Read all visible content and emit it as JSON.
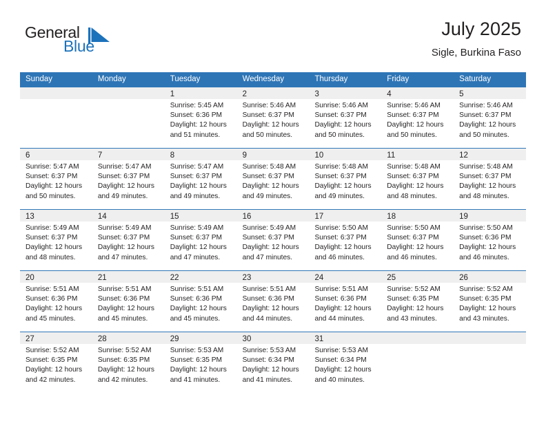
{
  "brand": {
    "name_part1": "General",
    "name_part2": "Blue",
    "logo_icon": "blue-triangle-flag-icon",
    "accent_color": "#1c72bb"
  },
  "header": {
    "title": "July 2025",
    "subtitle": "Sigle, Burkina Faso"
  },
  "theme": {
    "header_row_bg": "#2e75b6",
    "day_strip_bg": "#efefef",
    "grid_line": "#2e75b6",
    "text": "#221f1f"
  },
  "weekdays": [
    "Sunday",
    "Monday",
    "Tuesday",
    "Wednesday",
    "Thursday",
    "Friday",
    "Saturday"
  ],
  "weeks": [
    [
      {
        "day": "",
        "sunrise": "",
        "sunset": "",
        "daylight1": "",
        "daylight2": "",
        "empty": true
      },
      {
        "day": "",
        "sunrise": "",
        "sunset": "",
        "daylight1": "",
        "daylight2": "",
        "empty": true
      },
      {
        "day": "1",
        "sunrise": "Sunrise: 5:45 AM",
        "sunset": "Sunset: 6:36 PM",
        "daylight1": "Daylight: 12 hours",
        "daylight2": "and 51 minutes."
      },
      {
        "day": "2",
        "sunrise": "Sunrise: 5:46 AM",
        "sunset": "Sunset: 6:37 PM",
        "daylight1": "Daylight: 12 hours",
        "daylight2": "and 50 minutes."
      },
      {
        "day": "3",
        "sunrise": "Sunrise: 5:46 AM",
        "sunset": "Sunset: 6:37 PM",
        "daylight1": "Daylight: 12 hours",
        "daylight2": "and 50 minutes."
      },
      {
        "day": "4",
        "sunrise": "Sunrise: 5:46 AM",
        "sunset": "Sunset: 6:37 PM",
        "daylight1": "Daylight: 12 hours",
        "daylight2": "and 50 minutes."
      },
      {
        "day": "5",
        "sunrise": "Sunrise: 5:46 AM",
        "sunset": "Sunset: 6:37 PM",
        "daylight1": "Daylight: 12 hours",
        "daylight2": "and 50 minutes."
      }
    ],
    [
      {
        "day": "6",
        "sunrise": "Sunrise: 5:47 AM",
        "sunset": "Sunset: 6:37 PM",
        "daylight1": "Daylight: 12 hours",
        "daylight2": "and 50 minutes."
      },
      {
        "day": "7",
        "sunrise": "Sunrise: 5:47 AM",
        "sunset": "Sunset: 6:37 PM",
        "daylight1": "Daylight: 12 hours",
        "daylight2": "and 49 minutes."
      },
      {
        "day": "8",
        "sunrise": "Sunrise: 5:47 AM",
        "sunset": "Sunset: 6:37 PM",
        "daylight1": "Daylight: 12 hours",
        "daylight2": "and 49 minutes."
      },
      {
        "day": "9",
        "sunrise": "Sunrise: 5:48 AM",
        "sunset": "Sunset: 6:37 PM",
        "daylight1": "Daylight: 12 hours",
        "daylight2": "and 49 minutes."
      },
      {
        "day": "10",
        "sunrise": "Sunrise: 5:48 AM",
        "sunset": "Sunset: 6:37 PM",
        "daylight1": "Daylight: 12 hours",
        "daylight2": "and 49 minutes."
      },
      {
        "day": "11",
        "sunrise": "Sunrise: 5:48 AM",
        "sunset": "Sunset: 6:37 PM",
        "daylight1": "Daylight: 12 hours",
        "daylight2": "and 48 minutes."
      },
      {
        "day": "12",
        "sunrise": "Sunrise: 5:48 AM",
        "sunset": "Sunset: 6:37 PM",
        "daylight1": "Daylight: 12 hours",
        "daylight2": "and 48 minutes."
      }
    ],
    [
      {
        "day": "13",
        "sunrise": "Sunrise: 5:49 AM",
        "sunset": "Sunset: 6:37 PM",
        "daylight1": "Daylight: 12 hours",
        "daylight2": "and 48 minutes."
      },
      {
        "day": "14",
        "sunrise": "Sunrise: 5:49 AM",
        "sunset": "Sunset: 6:37 PM",
        "daylight1": "Daylight: 12 hours",
        "daylight2": "and 47 minutes."
      },
      {
        "day": "15",
        "sunrise": "Sunrise: 5:49 AM",
        "sunset": "Sunset: 6:37 PM",
        "daylight1": "Daylight: 12 hours",
        "daylight2": "and 47 minutes."
      },
      {
        "day": "16",
        "sunrise": "Sunrise: 5:49 AM",
        "sunset": "Sunset: 6:37 PM",
        "daylight1": "Daylight: 12 hours",
        "daylight2": "and 47 minutes."
      },
      {
        "day": "17",
        "sunrise": "Sunrise: 5:50 AM",
        "sunset": "Sunset: 6:37 PM",
        "daylight1": "Daylight: 12 hours",
        "daylight2": "and 46 minutes."
      },
      {
        "day": "18",
        "sunrise": "Sunrise: 5:50 AM",
        "sunset": "Sunset: 6:37 PM",
        "daylight1": "Daylight: 12 hours",
        "daylight2": "and 46 minutes."
      },
      {
        "day": "19",
        "sunrise": "Sunrise: 5:50 AM",
        "sunset": "Sunset: 6:36 PM",
        "daylight1": "Daylight: 12 hours",
        "daylight2": "and 46 minutes."
      }
    ],
    [
      {
        "day": "20",
        "sunrise": "Sunrise: 5:51 AM",
        "sunset": "Sunset: 6:36 PM",
        "daylight1": "Daylight: 12 hours",
        "daylight2": "and 45 minutes."
      },
      {
        "day": "21",
        "sunrise": "Sunrise: 5:51 AM",
        "sunset": "Sunset: 6:36 PM",
        "daylight1": "Daylight: 12 hours",
        "daylight2": "and 45 minutes."
      },
      {
        "day": "22",
        "sunrise": "Sunrise: 5:51 AM",
        "sunset": "Sunset: 6:36 PM",
        "daylight1": "Daylight: 12 hours",
        "daylight2": "and 45 minutes."
      },
      {
        "day": "23",
        "sunrise": "Sunrise: 5:51 AM",
        "sunset": "Sunset: 6:36 PM",
        "daylight1": "Daylight: 12 hours",
        "daylight2": "and 44 minutes."
      },
      {
        "day": "24",
        "sunrise": "Sunrise: 5:51 AM",
        "sunset": "Sunset: 6:36 PM",
        "daylight1": "Daylight: 12 hours",
        "daylight2": "and 44 minutes."
      },
      {
        "day": "25",
        "sunrise": "Sunrise: 5:52 AM",
        "sunset": "Sunset: 6:35 PM",
        "daylight1": "Daylight: 12 hours",
        "daylight2": "and 43 minutes."
      },
      {
        "day": "26",
        "sunrise": "Sunrise: 5:52 AM",
        "sunset": "Sunset: 6:35 PM",
        "daylight1": "Daylight: 12 hours",
        "daylight2": "and 43 minutes."
      }
    ],
    [
      {
        "day": "27",
        "sunrise": "Sunrise: 5:52 AM",
        "sunset": "Sunset: 6:35 PM",
        "daylight1": "Daylight: 12 hours",
        "daylight2": "and 42 minutes."
      },
      {
        "day": "28",
        "sunrise": "Sunrise: 5:52 AM",
        "sunset": "Sunset: 6:35 PM",
        "daylight1": "Daylight: 12 hours",
        "daylight2": "and 42 minutes."
      },
      {
        "day": "29",
        "sunrise": "Sunrise: 5:53 AM",
        "sunset": "Sunset: 6:35 PM",
        "daylight1": "Daylight: 12 hours",
        "daylight2": "and 41 minutes."
      },
      {
        "day": "30",
        "sunrise": "Sunrise: 5:53 AM",
        "sunset": "Sunset: 6:34 PM",
        "daylight1": "Daylight: 12 hours",
        "daylight2": "and 41 minutes."
      },
      {
        "day": "31",
        "sunrise": "Sunrise: 5:53 AM",
        "sunset": "Sunset: 6:34 PM",
        "daylight1": "Daylight: 12 hours",
        "daylight2": "and 40 minutes."
      },
      {
        "day": "",
        "sunrise": "",
        "sunset": "",
        "daylight1": "",
        "daylight2": "",
        "empty": true
      },
      {
        "day": "",
        "sunrise": "",
        "sunset": "",
        "daylight1": "",
        "daylight2": "",
        "empty": true
      }
    ]
  ]
}
